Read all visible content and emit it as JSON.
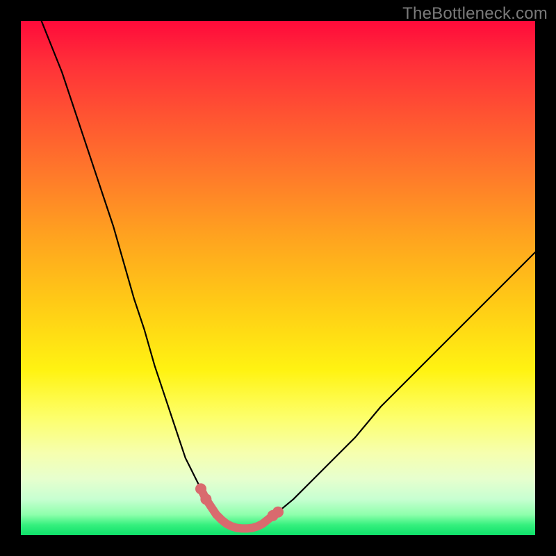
{
  "watermark": "TheBottleneck.com",
  "chart_data": {
    "type": "line",
    "title": "",
    "xlabel": "",
    "ylabel": "",
    "xlim": [
      0,
      100
    ],
    "ylim": [
      0,
      100
    ],
    "series": [
      {
        "name": "bottleneck-curve",
        "x": [
          4,
          6,
          8,
          10,
          12,
          14,
          16,
          18,
          20,
          22,
          24,
          26,
          28,
          30,
          32,
          33,
          34,
          35,
          36,
          37,
          38,
          39,
          40,
          41,
          42,
          43,
          44,
          45,
          46,
          47,
          48,
          50,
          53,
          56,
          60,
          65,
          70,
          75,
          80,
          85,
          90,
          95,
          100
        ],
        "y": [
          100,
          95,
          90,
          84,
          78,
          72,
          66,
          60,
          53,
          46,
          40,
          33,
          27,
          21,
          15,
          13,
          11,
          9,
          7,
          5.5,
          4,
          3,
          2.2,
          1.7,
          1.4,
          1.3,
          1.3,
          1.4,
          1.7,
          2.2,
          3,
          4.5,
          7,
          10,
          14,
          19,
          25,
          30,
          35,
          40,
          45,
          50,
          55
        ]
      }
    ],
    "highlight": {
      "name": "min-region",
      "x": [
        35,
        36,
        37,
        38,
        39,
        40,
        41,
        42,
        43,
        44,
        45,
        46,
        47,
        48,
        49,
        50
      ],
      "y": [
        9,
        7,
        5.5,
        4,
        3,
        2.2,
        1.7,
        1.4,
        1.3,
        1.3,
        1.4,
        1.7,
        2.2,
        3,
        3.8,
        4.5
      ]
    },
    "colors": {
      "curve": "#000000",
      "highlight": "#d96a6e",
      "gradient_top": "#ff0a3a",
      "gradient_bottom": "#0ee06a"
    }
  }
}
